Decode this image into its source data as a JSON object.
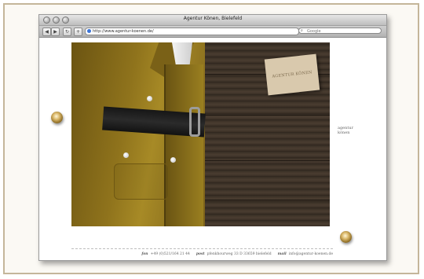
{
  "window": {
    "title": "Agentur Könen, Bielefeld",
    "address": "http://www.agentur-koenen.de/",
    "search_placeholder": "Google"
  },
  "toolbar": {
    "back": "◀",
    "forward": "▶",
    "reload": "↻",
    "add": "+"
  },
  "page": {
    "card_text": "AGENTUR KÖNEN",
    "side_label_line1": "agentur",
    "side_label_line2": "könen"
  },
  "footer": {
    "fon_label": "fon",
    "fon_value": "+49 (0)521/164 21 44",
    "post_label": "post",
    "post_value": "pfenkhourweg 33  D 33659 bielefeld",
    "mail_label": "mail",
    "mail_value": "info@agentur-koenen.de"
  },
  "colors": {
    "frame_border": "#c4b69a",
    "jacket": "#8f731c",
    "wood": "#3a2f25",
    "knob": "#d8b567"
  }
}
